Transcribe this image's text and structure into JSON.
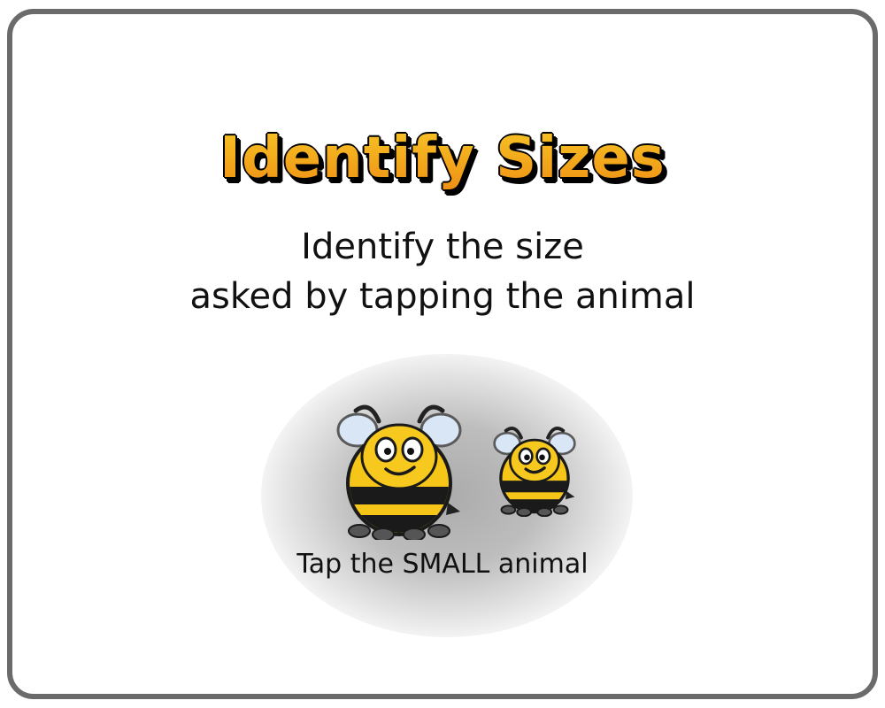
{
  "game": {
    "title": "Identify Sizes",
    "instructions_line1": "Identify the size",
    "instructions_line2": "asked by tapping the animal",
    "prompt": "Tap the SMALL animal"
  },
  "animals": [
    {
      "icon": "bee-icon",
      "size": "big"
    },
    {
      "icon": "bee-icon",
      "size": "small"
    }
  ],
  "colors": {
    "title_fill": "#f3ad1d",
    "title_outline": "#000000",
    "bee_yellow": "#f5c518",
    "bee_stripe": "#1a1a1a",
    "frame_border": "#6b6b6b"
  }
}
